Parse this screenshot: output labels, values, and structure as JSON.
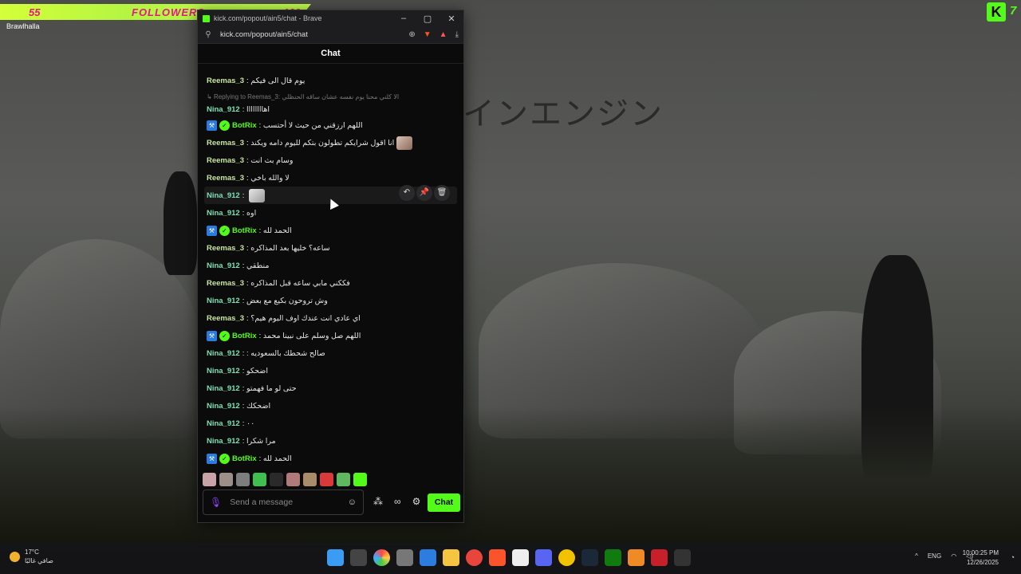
{
  "overlay": {
    "left_count": "55",
    "followers_label": "FOLLOWERS",
    "goal": "100",
    "game": "Brawlhalla",
    "corner_number": "7",
    "corner_logo": "K"
  },
  "wallpaper": {
    "japanese_text": "インエンジン"
  },
  "browser": {
    "tab_title": "kick.com/popout/ain5/chat - Brave",
    "url": "kick.com/popout/ain5/chat",
    "controls": {
      "minimize": "–",
      "maximize": "▢",
      "close": "✕"
    }
  },
  "chat": {
    "header": "Chat",
    "messages": [
      {
        "user": "Reemas_3",
        "text": "يوم قال الى فيكم"
      },
      {
        "reply_to": "Replying to Reemas_3:",
        "reply_text": "الا كلني محنا يوم نفسه عشان ساقه الحنظلي"
      },
      {
        "user": "Nina_912",
        "text": "اهاااااااا"
      },
      {
        "user": "BotRix",
        "text": "اللهم ارزقني من حيث لا أحتسب"
      },
      {
        "user": "Reemas_3",
        "text": "انا اقول شرايكم تطولون بتكم لليوم دامه ويكند"
      },
      {
        "user": "Reemas_3",
        "text": "وسام بث انت"
      },
      {
        "user": "Reemas_3",
        "text": "لا والله باخي"
      },
      {
        "user": "Nina_912",
        "text": ""
      },
      {
        "user": "Nina_912",
        "text": "اوه"
      },
      {
        "user": "BotRix",
        "text": "الحمد لله"
      },
      {
        "user": "Reemas_3",
        "text": "ساعه؟ خليها بعد المذاكره"
      },
      {
        "user": "Nina_912",
        "text": "منطقي"
      },
      {
        "user": "Reemas_3",
        "text": "فككني مابي ساعه قبل المذاكره"
      },
      {
        "user": "Nina_912",
        "text": "وش تروحون بكيع مع بعض"
      },
      {
        "user": "Reemas_3",
        "text": "اي عادي انت عندك اوف اليوم هيم؟"
      },
      {
        "user": "BotRix",
        "text": "اللهم صل وسلم على نبينا محمد"
      },
      {
        "user": "Nina_912",
        "text": "صالح شحطك بالسعوديه :"
      },
      {
        "user": "Nina_912",
        "text": "اضحكو"
      },
      {
        "user": "Nina_912",
        "text": "حتى لو ما فهمتو"
      },
      {
        "user": "Nina_912",
        "text": "اضحكك"
      },
      {
        "user": "Nina_912",
        "text": "٠٠"
      },
      {
        "user": "Nina_912",
        "text": "مرا شكرا"
      },
      {
        "user": "BotRix",
        "text": "الحمد لله"
      }
    ],
    "actions": {
      "reply": "↶",
      "pin": "📌",
      "delete": "🗑"
    },
    "composer": {
      "placeholder": "Send a message",
      "send_label": "Chat"
    }
  },
  "taskbar": {
    "temperature": "17°C",
    "weather_desc": "صافي غالبًا",
    "language": "ENG",
    "time": "10:00:25 PM",
    "date": "12/26/2025"
  }
}
